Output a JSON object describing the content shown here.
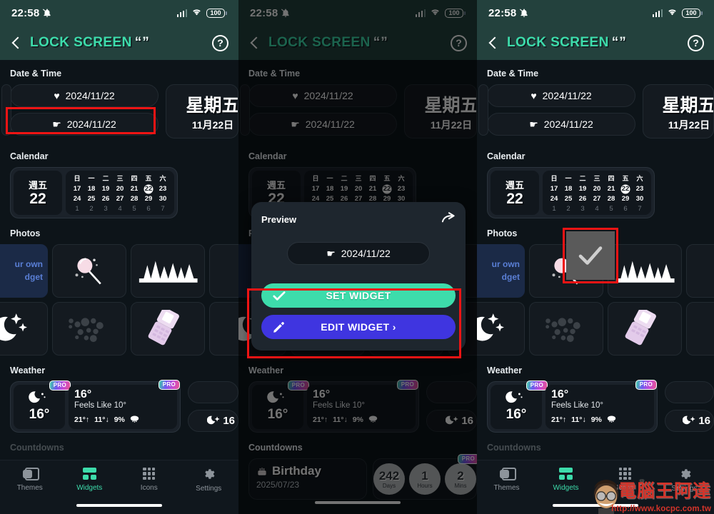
{
  "statusbar": {
    "time": "22:58",
    "battery": "100",
    "mute_icon": "bell-slash-icon",
    "signal_icon": "cellular-signal-icon",
    "wifi_icon": "wifi-icon"
  },
  "header": {
    "back_icon": "chevron-left-icon",
    "title": "LOCK SCREEN",
    "quotes": "“”",
    "help_icon": "help-circle-icon"
  },
  "sections": {
    "date_time": "Date & Time",
    "calendar": "Calendar",
    "photos": "Photos",
    "weather": "Weather",
    "countdowns": "Countdowns"
  },
  "date_time": {
    "row1": {
      "icon": "heart-icon",
      "glyph": "♥",
      "label": "2024/11/22"
    },
    "row2": {
      "icon": "pointing-hand-icon",
      "glyph": "☛",
      "label": "2024/11/22"
    },
    "big_widget": {
      "weekday": "星期五",
      "monthday": "11月22日"
    }
  },
  "calendar_widget": {
    "weekday": "週五",
    "day": "22",
    "headers": [
      "日",
      "一",
      "二",
      "三",
      "四",
      "五",
      "六"
    ],
    "weeks": [
      [
        "17",
        "18",
        "19",
        "20",
        "21",
        "22",
        "23"
      ],
      [
        "24",
        "25",
        "26",
        "27",
        "28",
        "29",
        "30"
      ],
      [
        "1",
        "2",
        "3",
        "4",
        "5",
        "6",
        "7"
      ]
    ],
    "today": "22",
    "dim_week_index": 2
  },
  "photos": {
    "promo_card": {
      "line1": "ur own",
      "line2": "dget"
    },
    "cards": [
      {
        "icon": "lollipop-icon"
      },
      {
        "icon": "pine-forest-icon"
      },
      {
        "icon": "moon-stars-icon"
      },
      {
        "icon": "bubbles-icon"
      },
      {
        "icon": "flip-phone-icon"
      }
    ]
  },
  "weather": {
    "pro_badge": "PRO",
    "small": {
      "icon": "moon-cloud-icon",
      "temp": "16°"
    },
    "large": {
      "temp": "16°",
      "feels_like": "Feels Like 10°",
      "high": "21°↑",
      "low": "11°↓",
      "precip": "9%",
      "precip_icon": "rain-cloud-icon",
      "icon": "moon-cloud-icon"
    },
    "stub_temp": "16"
  },
  "countdowns": {
    "card": {
      "icon": "birthday-cake-icon",
      "title": "Birthday",
      "date": "2025/07/23"
    },
    "bubbles": [
      {
        "value": "242",
        "unit": "Days"
      },
      {
        "value": "1",
        "unit": "Hours"
      },
      {
        "value": "2",
        "unit": "Mins"
      }
    ],
    "pro_badge": "PRO"
  },
  "nav": {
    "items": [
      {
        "label": "Themes",
        "icon": "themes-icon",
        "active": false
      },
      {
        "label": "Widgets",
        "icon": "widgets-icon",
        "active": true
      },
      {
        "label": "Icons",
        "icon": "icons-grid-icon",
        "active": false
      },
      {
        "label": "Settings",
        "icon": "gear-icon",
        "active": false
      }
    ]
  },
  "modal": {
    "title": "Preview",
    "share_icon": "share-arrow-icon",
    "preview_pill": {
      "glyph": "☛",
      "label": "2024/11/22"
    },
    "set_button": {
      "label": "SET WIDGET",
      "icon": "check-icon"
    },
    "edit_button": {
      "label": "EDIT WIDGET ›",
      "icon": "pencil-icon"
    }
  },
  "overlay": {
    "check_icon": "check-icon"
  },
  "watermark": {
    "text": "電腦王阿達",
    "url": "http://www.kocpc.com.tw"
  },
  "colors": {
    "accent_teal": "#3ddcab",
    "header_bg": "#23413d",
    "panel_bg": "#0d1419",
    "edit_purple": "#3f35e0",
    "highlight_red": "#f01414",
    "promo_blue": "#1b2a47"
  }
}
